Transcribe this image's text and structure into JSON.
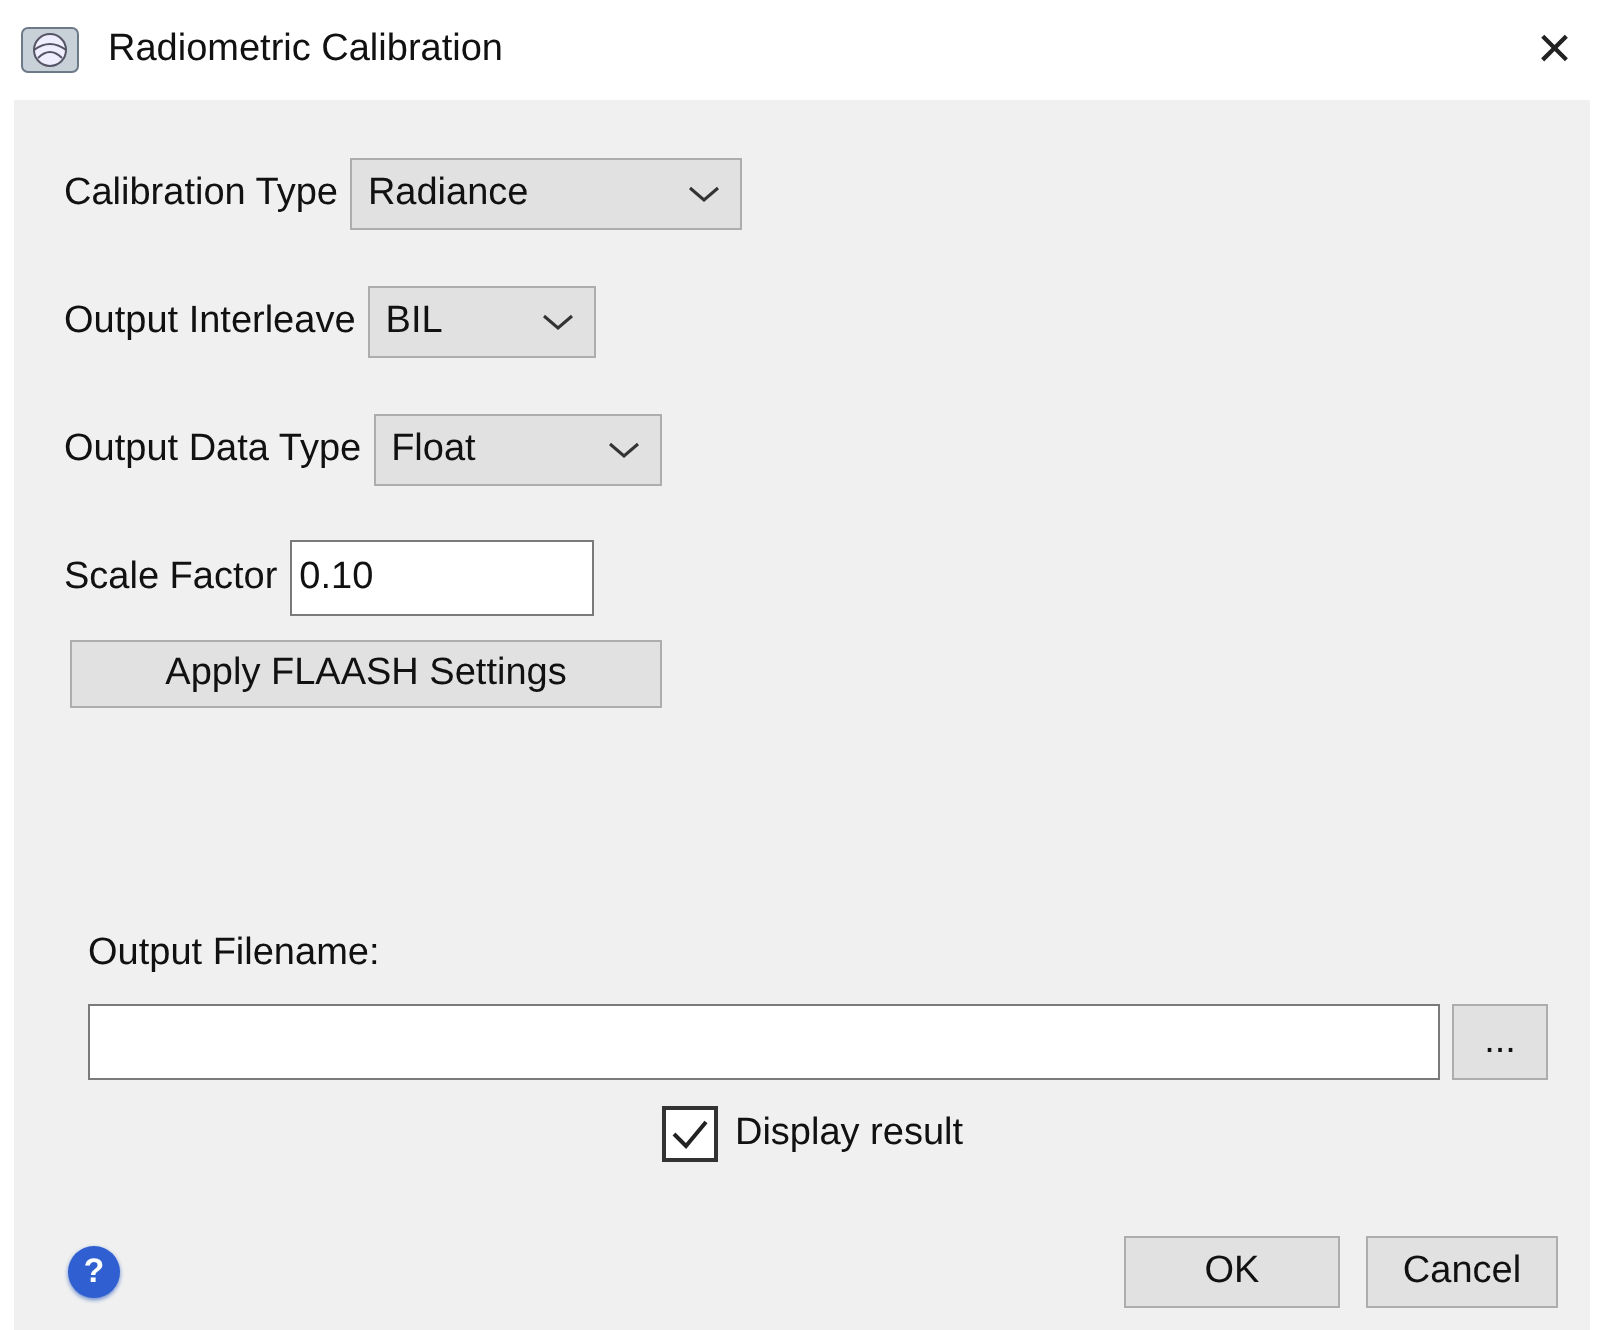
{
  "window": {
    "title": "Radiometric Calibration",
    "close": "×"
  },
  "fields": [
    {
      "kind": "dropdown",
      "label": "Calibration Type",
      "value": "Radiance"
    },
    {
      "kind": "dropdown",
      "label": "Output Interleave",
      "value": "BIL"
    },
    {
      "kind": "dropdown",
      "label": "Output Data Type",
      "value": "Float"
    },
    {
      "kind": "text",
      "label": "Scale Factor",
      "value": "0.10"
    }
  ],
  "apply_button": "Apply FLAASH Settings",
  "output": {
    "label": "Output Filename:",
    "browse": "..."
  },
  "display_result": {
    "label": "Display result",
    "checked": true
  },
  "help": "?",
  "buttons": [
    "OK",
    "Cancel"
  ]
}
